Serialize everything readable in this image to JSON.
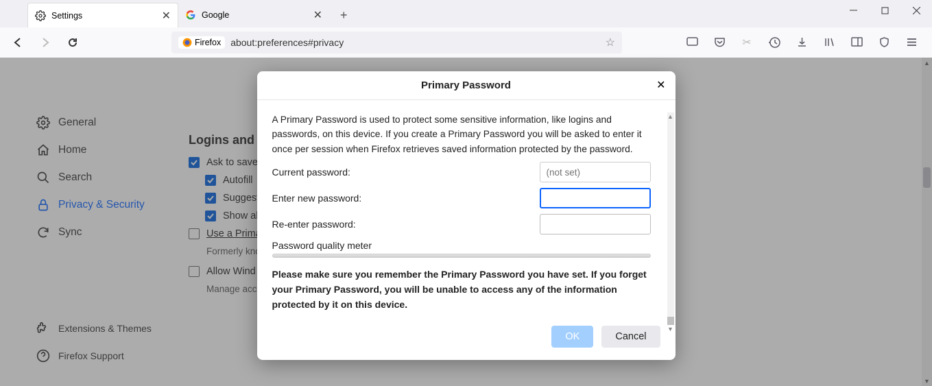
{
  "tabs": [
    {
      "label": "Settings",
      "active": true
    },
    {
      "label": "Google",
      "active": false
    }
  ],
  "urlbar": {
    "identity": "Firefox",
    "url": "about:preferences#privacy"
  },
  "sidebar": {
    "items": [
      {
        "icon": "gear",
        "label": "General"
      },
      {
        "icon": "home",
        "label": "Home"
      },
      {
        "icon": "search",
        "label": "Search"
      },
      {
        "icon": "lock",
        "label": "Privacy & Security",
        "selected": true
      },
      {
        "icon": "sync",
        "label": "Sync"
      }
    ],
    "bottom": [
      {
        "icon": "puzzle",
        "label": "Extensions & Themes"
      },
      {
        "icon": "help",
        "label": "Firefox Support"
      }
    ]
  },
  "page": {
    "section_title": "Logins and P",
    "rows": [
      {
        "checked": true,
        "label": "Ask to save"
      },
      {
        "checked": true,
        "indent": true,
        "label": "Autofill"
      },
      {
        "checked": true,
        "indent": true,
        "label": "Suggest"
      },
      {
        "checked": true,
        "indent": true,
        "label": "Show al"
      },
      {
        "checked": false,
        "label": "Use a Prima"
      },
      {
        "note": "Formerly kno"
      },
      {
        "checked": false,
        "label": "Allow Wind"
      },
      {
        "note": "Manage acc"
      }
    ]
  },
  "dialog": {
    "title": "Primary Password",
    "description": "A Primary Password is used to protect some sensitive information, like logins and passwords, on this device. If you create a Primary Password you will be asked to enter it once per session when Firefox retrieves saved information protected by the password.",
    "current_label": "Current password:",
    "current_placeholder": "(not set)",
    "new_label": "Enter new password:",
    "reenter_label": "Re-enter password:",
    "meter_label": "Password quality meter",
    "warning": "Please make sure you remember the Primary Password you have set. If you forget your Primary Password, you will be unable to access any of the information protected by it on this device.",
    "ok": "OK",
    "cancel": "Cancel"
  }
}
